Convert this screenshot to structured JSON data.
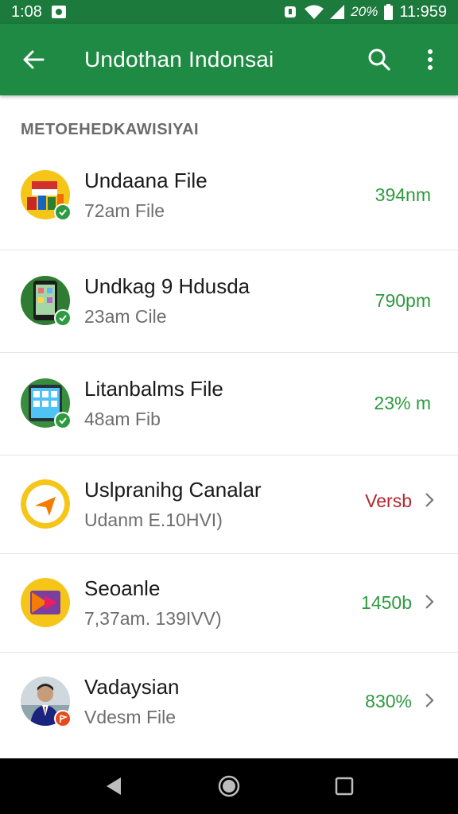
{
  "status_bar": {
    "time_left": "1:08",
    "battery_percent": "20%",
    "time_right": "11:959"
  },
  "app_bar": {
    "title": "Undothan Indonsai"
  },
  "section_header": "METOEHEDKAWISIYAI",
  "colors": {
    "primary": "#1e8a43",
    "status_bar": "#1b7a3c",
    "green_text": "#2e9a40",
    "red_text": "#b3262d"
  },
  "items": [
    {
      "title": "Undaana File",
      "subtitle": "72am File",
      "meta": "394nm",
      "meta_color": "green",
      "icon": "flag-shop-icon",
      "badge": "check-badge-icon",
      "chevron": false
    },
    {
      "title": "Undkag 9 Hdusda",
      "subtitle": "23am Cile",
      "meta": "790pm",
      "meta_color": "green",
      "icon": "phone-app-icon",
      "badge": "check-badge-icon",
      "chevron": false
    },
    {
      "title": "Litanbalms File",
      "subtitle": "48am Fib",
      "meta": "23% m",
      "meta_color": "green",
      "icon": "tablet-app-icon",
      "badge": "check-badge-icon",
      "chevron": false
    },
    {
      "title": "Uslpranihg Canalar",
      "subtitle": "Udanm E.10HVI)",
      "meta": "Versb",
      "meta_color": "red",
      "icon": "compass-arrow-icon",
      "badge": "",
      "chevron": true
    },
    {
      "title": "Seoanle",
      "subtitle": "7,37am. 139IVV)",
      "meta": "1450b",
      "meta_color": "green",
      "icon": "media-play-icon",
      "badge": "",
      "chevron": true
    },
    {
      "title": "Vadaysian",
      "subtitle": "Vdesm File",
      "meta": "830%",
      "meta_color": "green",
      "icon": "person-photo-icon",
      "badge": "flag-badge-icon",
      "chevron": true
    }
  ]
}
